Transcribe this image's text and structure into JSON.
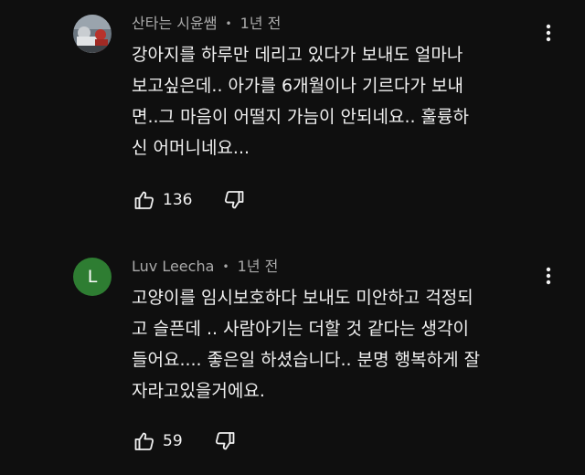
{
  "comments": [
    {
      "author": "산타는 시윤쌤",
      "separator": "•",
      "time": "1년 전",
      "avatar_type": "photo",
      "lines": [
        "강아지를 하루만 데리고 있다가 보내도 얼마나",
        "보고싶은데.. 아가를 6개월이나 기르다가 보내",
        "면..그 마음이 어떨지 가늠이 안되네요.. 훌륭하",
        "신 어머니네요..."
      ],
      "likes": "136",
      "like_icon": "thumbs-up-icon",
      "dislike_icon": "thumbs-down-icon",
      "menu_icon": "more-vertical-icon"
    },
    {
      "author": "Luv Leecha",
      "separator": "•",
      "time": "1년 전",
      "avatar_type": "letter",
      "avatar_letter": "L",
      "avatar_color": "#2e7d32",
      "lines": [
        "고양이를 임시보호하다 보내도 미안하고 걱정되",
        "고 슬픈데 .. 사람아기는 더할 것 같다는 생각이",
        "들어요.... 좋은일 하셨습니다.. 분명 행복하게 잘",
        "자라고있을거에요."
      ],
      "likes": "59",
      "like_icon": "thumbs-up-icon",
      "dislike_icon": "thumbs-down-icon",
      "menu_icon": "more-vertical-icon"
    }
  ],
  "colors": {
    "background": "#0f0f0f",
    "text": "#f1f1f1",
    "meta": "#aaaaaa"
  }
}
